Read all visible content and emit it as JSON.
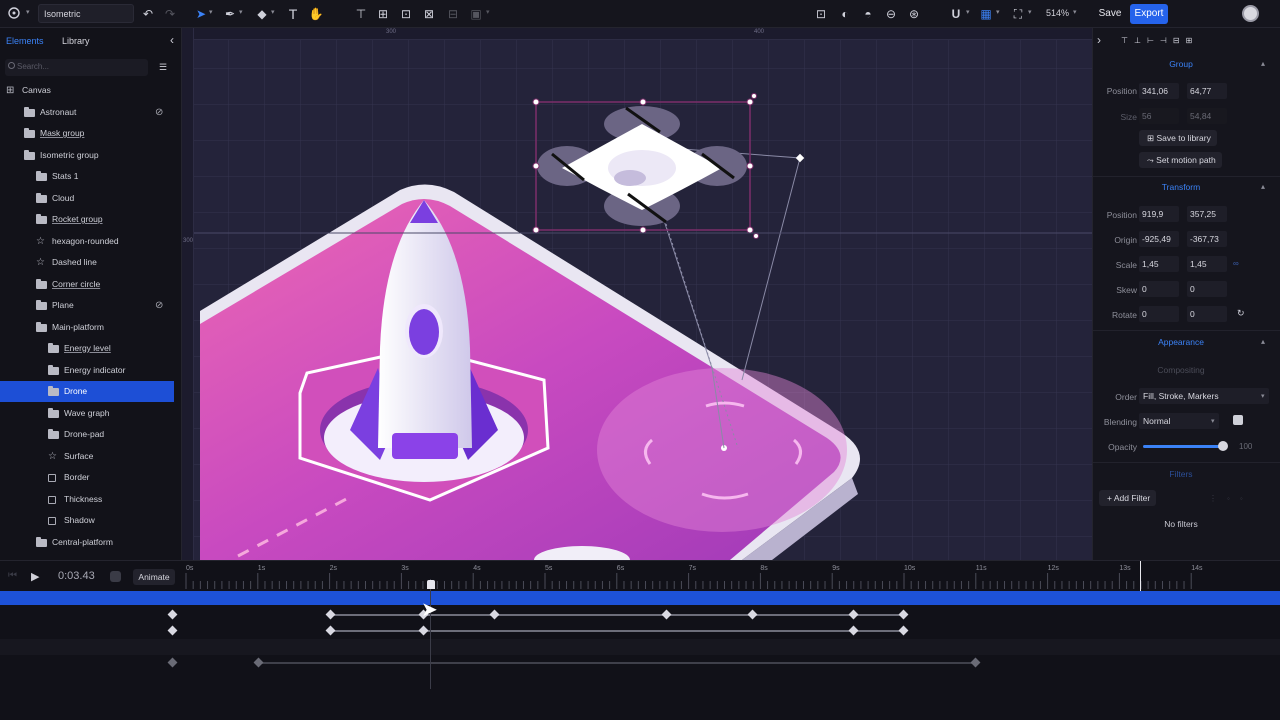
{
  "toolbar": {
    "doc_name": "Isometric",
    "zoom": "514%",
    "save_label": "Save",
    "export_label": "Export"
  },
  "left_panel": {
    "tabs": [
      "Elements",
      "Library"
    ],
    "search_placeholder": "Search...",
    "layers": [
      {
        "label": "Canvas",
        "icon": "canvas-icon",
        "indent": 0
      },
      {
        "label": "Astronaut",
        "icon": "folder-icon",
        "indent": 1,
        "hidden": true
      },
      {
        "label": "Mask group",
        "icon": "folder-icon",
        "indent": 1,
        "underline": true
      },
      {
        "label": "Isometric group",
        "icon": "folder-open-icon",
        "indent": 1
      },
      {
        "label": "Stats 1",
        "icon": "folder-icon",
        "indent": 2
      },
      {
        "label": "Cloud",
        "icon": "folder-icon",
        "indent": 2
      },
      {
        "label": "Rocket group",
        "icon": "folder-icon",
        "indent": 2,
        "underline": true
      },
      {
        "label": "hexagon-rounded",
        "icon": "star-icon",
        "indent": 2
      },
      {
        "label": "Dashed line",
        "icon": "star-icon",
        "indent": 2
      },
      {
        "label": "Corner circle",
        "icon": "folder-icon",
        "indent": 2,
        "underline": true
      },
      {
        "label": "Plane",
        "icon": "folder-icon",
        "indent": 2,
        "hidden": true
      },
      {
        "label": "Main-platform",
        "icon": "folder-open-icon",
        "indent": 2
      },
      {
        "label": "Energy level",
        "icon": "folder-icon",
        "indent": 3,
        "underline": true
      },
      {
        "label": "Energy indicator",
        "icon": "folder-icon",
        "indent": 3
      },
      {
        "label": "Drone",
        "icon": "folder-icon",
        "indent": 3,
        "selected": true
      },
      {
        "label": "Wave graph",
        "icon": "folder-icon",
        "indent": 3
      },
      {
        "label": "Drone-pad",
        "icon": "folder-icon",
        "indent": 3
      },
      {
        "label": "Surface",
        "icon": "star-icon",
        "indent": 3
      },
      {
        "label": "Border",
        "icon": "square-icon",
        "indent": 3
      },
      {
        "label": "Thickness",
        "icon": "square-icon",
        "indent": 3
      },
      {
        "label": "Shadow",
        "icon": "square-icon",
        "indent": 3
      },
      {
        "label": "Central-platform",
        "icon": "folder-icon",
        "indent": 2
      }
    ]
  },
  "rulers": {
    "top": [
      "300",
      "400"
    ],
    "left": [
      "300"
    ]
  },
  "right_panel": {
    "group": {
      "title": "Group",
      "position_label": "Position",
      "position_x": "341,06",
      "position_y": "64,77",
      "size_label": "Size",
      "size_w": "56",
      "size_h": "54,84",
      "save_library": "Save to library",
      "motion_path": "Set motion path"
    },
    "transform": {
      "title": "Transform",
      "position_label": "Position",
      "position_x": "919,9",
      "position_y": "357,25",
      "origin_label": "Origin",
      "origin_x": "-925,49",
      "origin_y": "-367,73",
      "scale_label": "Scale",
      "scale_x": "1,45",
      "scale_y": "1,45",
      "skew_label": "Skew",
      "skew_x": "0",
      "skew_y": "0",
      "rotate_label": "Rotate",
      "rotate_x": "0",
      "rotate_y": "0"
    },
    "appearance": {
      "title": "Appearance",
      "compositing": "Compositing",
      "order_label": "Order",
      "order_value": "Fill, Stroke, Markers",
      "blending_label": "Blending",
      "blending_value": "Normal",
      "opacity_label": "Opacity",
      "opacity_value": "100",
      "opacity_level": 1.0
    },
    "filters": {
      "title": "Filters",
      "add_label": "+ Add Filter",
      "empty": "No filters"
    }
  },
  "timeline": {
    "current_time": "0:03.43",
    "animate_label": "Animate",
    "ticks": [
      "0s",
      "1s",
      "2s",
      "3s",
      "4s",
      "5s",
      "6s",
      "7s",
      "8s",
      "9s",
      "10s",
      "11s",
      "12s",
      "13s",
      "14s"
    ]
  },
  "colors": {
    "accent": "#2563eb",
    "platform_top": "#d24ab8",
    "rocket_purple": "#7b3fe0"
  }
}
